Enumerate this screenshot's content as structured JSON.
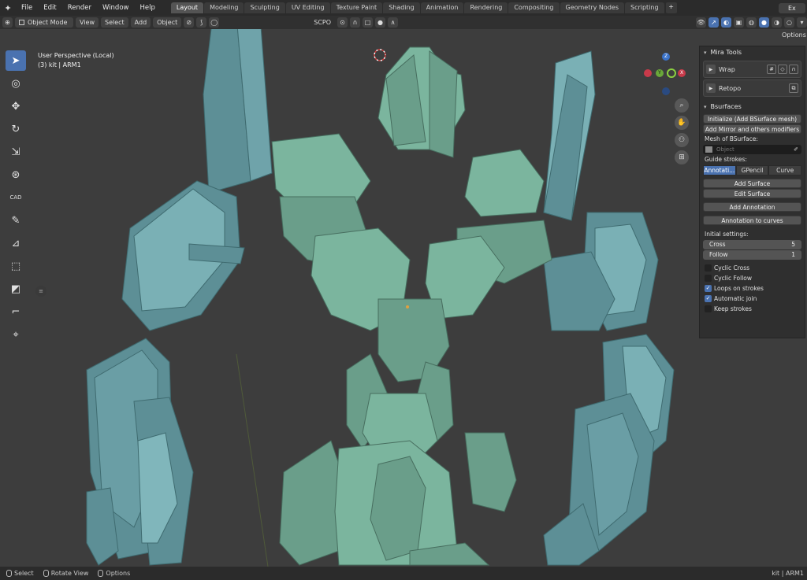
{
  "menubar": {
    "items": [
      "File",
      "Edit",
      "Render",
      "Window",
      "Help"
    ],
    "tabs": [
      "Layout",
      "Modeling",
      "Sculpting",
      "UV Editing",
      "Texture Paint",
      "Shading",
      "Animation",
      "Rendering",
      "Compositing",
      "Geometry Nodes",
      "Scripting"
    ],
    "active_tab": "Layout",
    "add_tab": "+",
    "scene_field": "Ex"
  },
  "header": {
    "mode": "Object Mode",
    "menus": [
      "View",
      "Select",
      "Add",
      "Object"
    ],
    "pivot": "SCPO",
    "options": "Options"
  },
  "viewport": {
    "perspective": "User Perspective (Local)",
    "object_info": "(3) kit | ARM1",
    "axes": {
      "z": "Z",
      "y": "Y",
      "x": "X"
    }
  },
  "toolbar": {
    "cad_label": "CAD"
  },
  "npanel": {
    "mira_title": "Mira Tools",
    "mira_items": [
      "Wrap",
      "Retopo"
    ],
    "bsurfaces_title": "Bsurfaces",
    "btn_initialize": "Initialize (Add BSurface mesh)",
    "btn_mirror": "Add Mirror and others modifiers",
    "mesh_label": "Mesh of BSurface:",
    "object_placeholder": "Object",
    "guide_label": "Guide strokes:",
    "guide_options": [
      "Annotati...",
      "GPencil",
      "Curve"
    ],
    "btn_add_surface": "Add Surface",
    "btn_edit_surface": "Edit Surface",
    "btn_add_annotation": "Add Annotation",
    "btn_annotation_curves": "Annotation to curves",
    "initial_label": "Initial settings:",
    "cross_label": "Cross",
    "cross_value": "5",
    "follow_label": "Follow",
    "follow_value": "1",
    "checks": [
      {
        "label": "Cyclic Cross",
        "on": false
      },
      {
        "label": "Cyclic Follow",
        "on": false
      },
      {
        "label": "Loops on strokes",
        "on": true
      },
      {
        "label": "Automatic join",
        "on": true
      },
      {
        "label": "Keep strokes",
        "on": false
      }
    ]
  },
  "statusbar": {
    "select": "Select",
    "rotate": "Rotate View",
    "options": "Options",
    "right": "kit | ARM1"
  },
  "colors": {
    "accent": "#4a72b0",
    "model_green": "#6a9e8a",
    "model_teal": "#5d8f96"
  }
}
